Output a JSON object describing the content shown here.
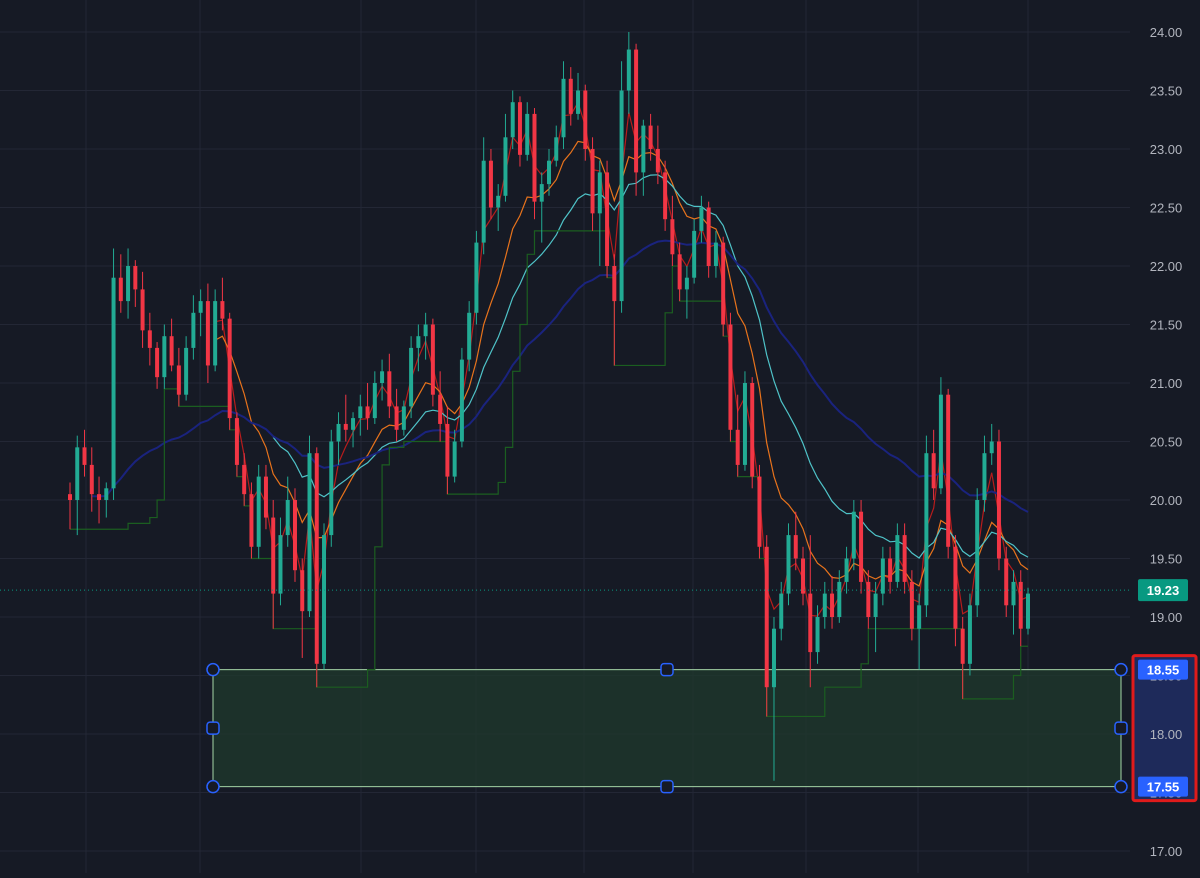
{
  "chart_data": {
    "type": "candlestick",
    "y_axis": {
      "side": "right",
      "ylim": [
        16.9,
        24.2
      ],
      "tick_labels": [
        "24.00",
        "23.50",
        "23.00",
        "22.50",
        "22.00",
        "21.50",
        "21.00",
        "20.50",
        "20.00",
        "19.50",
        "19.00",
        "18.50",
        "18.00",
        "17.50",
        "17.00"
      ],
      "tick_values": [
        24.0,
        23.5,
        23.0,
        22.5,
        22.0,
        21.5,
        21.0,
        20.5,
        20.0,
        19.5,
        19.0,
        18.5,
        18.0,
        17.5,
        17.0
      ]
    },
    "grid": true,
    "current_price": {
      "value": 19.23,
      "label": "19.23",
      "color": "#089981"
    },
    "colors": {
      "background": "#161a25",
      "up": "#22ab94",
      "down": "#f23645",
      "grid": "#232735",
      "axis_text": "#b2b5be",
      "ma_fast": "#b71c1c",
      "ma_mid": "#e8731c",
      "ma_slow": "#4fc3c8",
      "ma_long": "#1a237e",
      "trail_stop": "#1b5e20",
      "zone_fill": "#1f3a2c",
      "zone_border": "#a5d6a7",
      "handle": "#2962ff",
      "selection_highlight": "#e01b1b"
    },
    "candles": [
      {
        "o": 20.05,
        "h": 20.15,
        "l": 19.75,
        "c": 20.0
      },
      {
        "o": 20.0,
        "h": 20.55,
        "l": 19.7,
        "c": 20.45
      },
      {
        "o": 20.45,
        "h": 20.6,
        "l": 20.2,
        "c": 20.3
      },
      {
        "o": 20.3,
        "h": 20.45,
        "l": 19.9,
        "c": 20.05
      },
      {
        "o": 20.05,
        "h": 20.2,
        "l": 19.8,
        "c": 20.0
      },
      {
        "o": 20.0,
        "h": 20.15,
        "l": 19.85,
        "c": 20.1
      },
      {
        "o": 20.1,
        "h": 22.15,
        "l": 20.0,
        "c": 21.9
      },
      {
        "o": 21.9,
        "h": 22.1,
        "l": 21.6,
        "c": 21.7
      },
      {
        "o": 21.7,
        "h": 22.15,
        "l": 21.55,
        "c": 22.0
      },
      {
        "o": 22.0,
        "h": 22.05,
        "l": 21.65,
        "c": 21.8
      },
      {
        "o": 21.8,
        "h": 21.95,
        "l": 21.3,
        "c": 21.45
      },
      {
        "o": 21.45,
        "h": 21.6,
        "l": 21.15,
        "c": 21.3
      },
      {
        "o": 21.3,
        "h": 21.35,
        "l": 20.95,
        "c": 21.05
      },
      {
        "o": 21.05,
        "h": 21.5,
        "l": 20.95,
        "c": 21.4
      },
      {
        "o": 21.4,
        "h": 21.55,
        "l": 21.1,
        "c": 21.15
      },
      {
        "o": 21.15,
        "h": 21.3,
        "l": 20.8,
        "c": 20.9
      },
      {
        "o": 20.9,
        "h": 21.4,
        "l": 20.85,
        "c": 21.3
      },
      {
        "o": 21.3,
        "h": 21.75,
        "l": 21.2,
        "c": 21.6
      },
      {
        "o": 21.6,
        "h": 21.8,
        "l": 21.4,
        "c": 21.7
      },
      {
        "o": 21.7,
        "h": 21.85,
        "l": 21.0,
        "c": 21.15
      },
      {
        "o": 21.15,
        "h": 21.8,
        "l": 21.1,
        "c": 21.7
      },
      {
        "o": 21.7,
        "h": 21.9,
        "l": 21.45,
        "c": 21.55
      },
      {
        "o": 21.55,
        "h": 21.6,
        "l": 20.6,
        "c": 20.7
      },
      {
        "o": 20.7,
        "h": 20.75,
        "l": 20.2,
        "c": 20.3
      },
      {
        "o": 20.3,
        "h": 20.4,
        "l": 19.95,
        "c": 20.05
      },
      {
        "o": 20.05,
        "h": 20.15,
        "l": 19.5,
        "c": 19.6
      },
      {
        "o": 19.6,
        "h": 20.3,
        "l": 19.5,
        "c": 20.2
      },
      {
        "o": 20.2,
        "h": 20.3,
        "l": 19.75,
        "c": 19.85
      },
      {
        "o": 19.85,
        "h": 20.0,
        "l": 18.9,
        "c": 19.2
      },
      {
        "o": 19.2,
        "h": 19.85,
        "l": 19.1,
        "c": 19.7
      },
      {
        "o": 19.7,
        "h": 20.2,
        "l": 19.6,
        "c": 20.0
      },
      {
        "o": 20.0,
        "h": 20.1,
        "l": 19.3,
        "c": 19.4
      },
      {
        "o": 19.4,
        "h": 19.5,
        "l": 18.65,
        "c": 19.05
      },
      {
        "o": 19.05,
        "h": 20.55,
        "l": 19.0,
        "c": 20.4
      },
      {
        "o": 20.4,
        "h": 20.45,
        "l": 18.4,
        "c": 18.6
      },
      {
        "o": 18.6,
        "h": 19.8,
        "l": 18.55,
        "c": 19.7
      },
      {
        "o": 19.7,
        "h": 20.6,
        "l": 19.6,
        "c": 20.5
      },
      {
        "o": 20.5,
        "h": 20.75,
        "l": 20.3,
        "c": 20.65
      },
      {
        "o": 20.65,
        "h": 20.9,
        "l": 20.5,
        "c": 20.6
      },
      {
        "o": 20.6,
        "h": 20.75,
        "l": 20.45,
        "c": 20.7
      },
      {
        "o": 20.7,
        "h": 20.9,
        "l": 20.55,
        "c": 20.8
      },
      {
        "o": 20.8,
        "h": 21.0,
        "l": 20.6,
        "c": 20.7
      },
      {
        "o": 20.7,
        "h": 21.1,
        "l": 20.65,
        "c": 21.0
      },
      {
        "o": 21.0,
        "h": 21.2,
        "l": 20.85,
        "c": 21.1
      },
      {
        "o": 21.1,
        "h": 21.25,
        "l": 20.7,
        "c": 20.8
      },
      {
        "o": 20.8,
        "h": 20.95,
        "l": 20.5,
        "c": 20.6
      },
      {
        "o": 20.6,
        "h": 20.85,
        "l": 20.55,
        "c": 20.8
      },
      {
        "o": 20.8,
        "h": 21.4,
        "l": 20.7,
        "c": 21.3
      },
      {
        "o": 21.3,
        "h": 21.5,
        "l": 21.1,
        "c": 21.4
      },
      {
        "o": 21.4,
        "h": 21.6,
        "l": 21.2,
        "c": 21.5
      },
      {
        "o": 21.5,
        "h": 21.55,
        "l": 20.8,
        "c": 20.9
      },
      {
        "o": 20.9,
        "h": 21.1,
        "l": 20.5,
        "c": 20.65
      },
      {
        "o": 20.65,
        "h": 20.8,
        "l": 20.05,
        "c": 20.2
      },
      {
        "o": 20.2,
        "h": 20.6,
        "l": 20.15,
        "c": 20.5
      },
      {
        "o": 20.5,
        "h": 21.3,
        "l": 20.45,
        "c": 21.2
      },
      {
        "o": 21.2,
        "h": 21.7,
        "l": 21.1,
        "c": 21.6
      },
      {
        "o": 21.6,
        "h": 22.3,
        "l": 21.5,
        "c": 22.2
      },
      {
        "o": 22.2,
        "h": 23.1,
        "l": 22.1,
        "c": 22.9
      },
      {
        "o": 22.9,
        "h": 23.0,
        "l": 22.4,
        "c": 22.5
      },
      {
        "o": 22.5,
        "h": 22.7,
        "l": 22.3,
        "c": 22.6
      },
      {
        "o": 22.6,
        "h": 23.3,
        "l": 22.55,
        "c": 23.1
      },
      {
        "o": 23.1,
        "h": 23.5,
        "l": 23.0,
        "c": 23.4
      },
      {
        "o": 23.4,
        "h": 23.45,
        "l": 22.85,
        "c": 22.95
      },
      {
        "o": 22.95,
        "h": 23.4,
        "l": 22.9,
        "c": 23.3
      },
      {
        "o": 23.3,
        "h": 23.35,
        "l": 22.4,
        "c": 22.55
      },
      {
        "o": 22.55,
        "h": 22.8,
        "l": 22.2,
        "c": 22.7
      },
      {
        "o": 22.7,
        "h": 23.0,
        "l": 22.6,
        "c": 22.9
      },
      {
        "o": 22.9,
        "h": 23.2,
        "l": 22.85,
        "c": 23.1
      },
      {
        "o": 23.1,
        "h": 23.75,
        "l": 23.0,
        "c": 23.6
      },
      {
        "o": 23.6,
        "h": 23.7,
        "l": 23.2,
        "c": 23.3
      },
      {
        "o": 23.3,
        "h": 23.65,
        "l": 23.25,
        "c": 23.5
      },
      {
        "o": 23.5,
        "h": 23.55,
        "l": 22.9,
        "c": 23.0
      },
      {
        "o": 23.0,
        "h": 23.1,
        "l": 22.3,
        "c": 22.45
      },
      {
        "o": 22.45,
        "h": 22.9,
        "l": 22.0,
        "c": 22.8
      },
      {
        "o": 22.8,
        "h": 22.9,
        "l": 21.9,
        "c": 22.0
      },
      {
        "o": 22.0,
        "h": 22.1,
        "l": 21.15,
        "c": 21.7
      },
      {
        "o": 21.7,
        "h": 23.75,
        "l": 21.6,
        "c": 23.5
      },
      {
        "o": 23.5,
        "h": 24.0,
        "l": 23.3,
        "c": 23.85
      },
      {
        "o": 23.85,
        "h": 23.9,
        "l": 22.6,
        "c": 22.8
      },
      {
        "o": 22.8,
        "h": 23.25,
        "l": 22.6,
        "c": 23.2
      },
      {
        "o": 23.2,
        "h": 23.3,
        "l": 22.9,
        "c": 23.0
      },
      {
        "o": 23.0,
        "h": 23.2,
        "l": 22.7,
        "c": 22.8
      },
      {
        "o": 22.8,
        "h": 22.9,
        "l": 22.3,
        "c": 22.4
      },
      {
        "o": 22.4,
        "h": 22.6,
        "l": 22.0,
        "c": 22.1
      },
      {
        "o": 22.1,
        "h": 22.2,
        "l": 21.7,
        "c": 21.8
      },
      {
        "o": 21.8,
        "h": 22.0,
        "l": 21.55,
        "c": 21.9
      },
      {
        "o": 21.9,
        "h": 22.4,
        "l": 21.85,
        "c": 22.3
      },
      {
        "o": 22.3,
        "h": 22.6,
        "l": 22.2,
        "c": 22.5
      },
      {
        "o": 22.5,
        "h": 22.55,
        "l": 21.9,
        "c": 22.0
      },
      {
        "o": 22.0,
        "h": 22.3,
        "l": 21.9,
        "c": 22.2
      },
      {
        "o": 22.2,
        "h": 22.25,
        "l": 21.4,
        "c": 21.5
      },
      {
        "o": 21.5,
        "h": 21.6,
        "l": 20.5,
        "c": 20.6
      },
      {
        "o": 20.6,
        "h": 20.9,
        "l": 20.2,
        "c": 20.3
      },
      {
        "o": 20.3,
        "h": 21.1,
        "l": 20.25,
        "c": 21.0
      },
      {
        "o": 21.0,
        "h": 21.05,
        "l": 20.1,
        "c": 20.2
      },
      {
        "o": 20.2,
        "h": 20.3,
        "l": 19.5,
        "c": 19.6
      },
      {
        "o": 19.6,
        "h": 19.7,
        "l": 18.15,
        "c": 18.4
      },
      {
        "o": 18.4,
        "h": 19.0,
        "l": 17.6,
        "c": 18.9
      },
      {
        "o": 18.9,
        "h": 19.3,
        "l": 18.8,
        "c": 19.2
      },
      {
        "o": 19.2,
        "h": 19.8,
        "l": 19.1,
        "c": 19.7
      },
      {
        "o": 19.7,
        "h": 19.9,
        "l": 19.4,
        "c": 19.5
      },
      {
        "o": 19.5,
        "h": 19.6,
        "l": 19.1,
        "c": 19.2
      },
      {
        "o": 19.2,
        "h": 19.7,
        "l": 18.4,
        "c": 18.7
      },
      {
        "o": 18.7,
        "h": 19.1,
        "l": 18.6,
        "c": 19.0
      },
      {
        "o": 19.0,
        "h": 19.3,
        "l": 18.9,
        "c": 19.2
      },
      {
        "o": 19.2,
        "h": 19.35,
        "l": 18.9,
        "c": 19.0
      },
      {
        "o": 19.0,
        "h": 19.4,
        "l": 18.95,
        "c": 19.3
      },
      {
        "o": 19.3,
        "h": 19.6,
        "l": 19.2,
        "c": 19.5
      },
      {
        "o": 19.5,
        "h": 20.0,
        "l": 19.4,
        "c": 19.9
      },
      {
        "o": 19.9,
        "h": 20.0,
        "l": 19.2,
        "c": 19.3
      },
      {
        "o": 19.3,
        "h": 19.4,
        "l": 18.9,
        "c": 19.0
      },
      {
        "o": 19.0,
        "h": 19.3,
        "l": 18.7,
        "c": 19.2
      },
      {
        "o": 19.2,
        "h": 19.6,
        "l": 19.1,
        "c": 19.5
      },
      {
        "o": 19.5,
        "h": 19.6,
        "l": 19.2,
        "c": 19.3
      },
      {
        "o": 19.3,
        "h": 19.8,
        "l": 19.25,
        "c": 19.7
      },
      {
        "o": 19.7,
        "h": 19.8,
        "l": 19.2,
        "c": 19.3
      },
      {
        "o": 19.3,
        "h": 19.4,
        "l": 18.8,
        "c": 18.9
      },
      {
        "o": 18.9,
        "h": 19.2,
        "l": 18.55,
        "c": 19.1
      },
      {
        "o": 19.1,
        "h": 20.55,
        "l": 19.0,
        "c": 20.4
      },
      {
        "o": 20.4,
        "h": 20.6,
        "l": 20.0,
        "c": 20.1
      },
      {
        "o": 20.1,
        "h": 21.05,
        "l": 20.05,
        "c": 20.9
      },
      {
        "o": 20.9,
        "h": 20.95,
        "l": 19.5,
        "c": 19.6
      },
      {
        "o": 19.6,
        "h": 19.7,
        "l": 18.75,
        "c": 18.9
      },
      {
        "o": 18.9,
        "h": 19.0,
        "l": 18.3,
        "c": 18.6
      },
      {
        "o": 18.6,
        "h": 19.2,
        "l": 18.5,
        "c": 19.1
      },
      {
        "o": 19.1,
        "h": 20.1,
        "l": 19.0,
        "c": 20.0
      },
      {
        "o": 20.0,
        "h": 20.55,
        "l": 19.9,
        "c": 20.4
      },
      {
        "o": 20.4,
        "h": 20.65,
        "l": 20.3,
        "c": 20.5
      },
      {
        "o": 20.5,
        "h": 20.6,
        "l": 19.4,
        "c": 19.5
      },
      {
        "o": 19.5,
        "h": 19.6,
        "l": 19.0,
        "c": 19.1
      },
      {
        "o": 19.1,
        "h": 19.4,
        "l": 18.85,
        "c": 19.3
      },
      {
        "o": 19.3,
        "h": 19.4,
        "l": 18.75,
        "c": 18.9
      },
      {
        "o": 18.9,
        "h": 19.25,
        "l": 18.85,
        "c": 19.2
      }
    ],
    "overlay_lines": [
      {
        "key": "ma_fast",
        "smoothing": 3
      },
      {
        "key": "ma_mid",
        "smoothing": 10
      },
      {
        "key": "ma_slow",
        "smoothing": 20
      },
      {
        "key": "ma_long",
        "smoothing": 45
      },
      {
        "key": "trail_stop",
        "type": "step"
      }
    ],
    "zone": {
      "top": 18.55,
      "bottom": 17.55,
      "top_label": "18.55",
      "bottom_label": "17.55"
    }
  }
}
